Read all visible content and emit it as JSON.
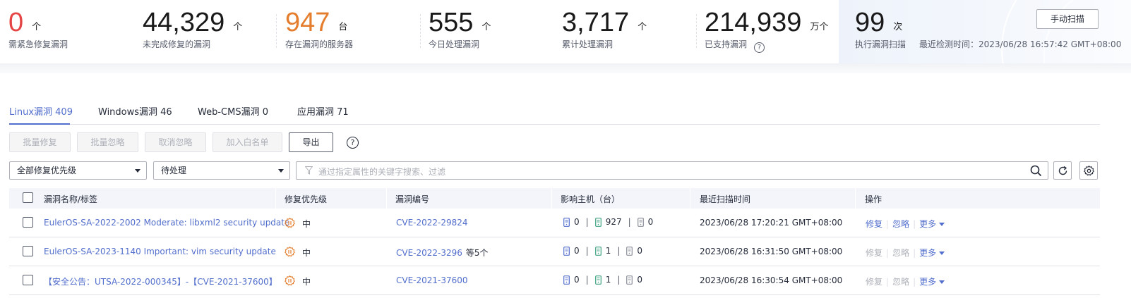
{
  "stats": [
    {
      "value": "0",
      "unit": "个",
      "label": "需紧急修复漏洞"
    },
    {
      "value": "44,329",
      "unit": "个",
      "label": "未完成修复的漏洞"
    },
    {
      "value": "947",
      "unit": "台",
      "label": "存在漏洞的服务器"
    },
    {
      "value": "555",
      "unit": "个",
      "label": "今日处理漏洞"
    },
    {
      "value": "3,717",
      "unit": "个",
      "label": "累计处理漏洞"
    },
    {
      "value": "214,939",
      "unit": "万个",
      "label": "已支持漏洞"
    }
  ],
  "scan": {
    "value": "99",
    "unit": "次",
    "label": "执行漏洞扫描",
    "last_check": "最近检测时间：2023/06/28 16:57:42 GMT+08:00",
    "manual_button": "手动扫描"
  },
  "colors": {
    "urgent": "#e54545",
    "server": "#e47d2d",
    "accent": "#526ecc"
  },
  "tabs": [
    {
      "label": "Linux漏洞 409"
    },
    {
      "label": "Windows漏洞 46"
    },
    {
      "label": "Web-CMS漏洞 0"
    },
    {
      "label": "应用漏洞 71"
    }
  ],
  "toolbar": {
    "batch_fix": "批量修复",
    "batch_ignore": "批量忽略",
    "cancel_ignore": "取消忽略",
    "add_whitelist": "加入白名单",
    "export": "导出"
  },
  "filters": {
    "priority": "全部修复优先级",
    "status": "待处理",
    "search_placeholder": "通过指定属性的关键字搜索、过滤"
  },
  "table": {
    "headers": {
      "name": "漏洞名称/标签",
      "priority": "修复优先级",
      "id": "漏洞编号",
      "hosts": "影响主机（台）",
      "last_scan": "最近扫描时间",
      "ops": "操作"
    },
    "rows": [
      {
        "name": "EulerOS-SA-2022-2002 Moderate: libxml2 security update",
        "priority": "中",
        "cve": "CVE-2022-29824",
        "cve_extra": "",
        "hosts": [
          "0",
          "927",
          "0"
        ],
        "time": "2023/06/28 17:20:21 GMT+08:00",
        "fix": "修复",
        "ignore": "忽略",
        "more": "更多",
        "ops_enabled": true
      },
      {
        "name": "EulerOS-SA-2023-1140 Important: vim security update",
        "priority": "中",
        "cve": "CVE-2022-3296",
        "cve_extra": "等5个",
        "hosts": [
          "0",
          "1",
          "0"
        ],
        "time": "2023/06/28 16:31:50 GMT+08:00",
        "fix": "修复",
        "ignore": "忽略",
        "more": "更多",
        "ops_enabled": false
      },
      {
        "name": "【安全公告：UTSA-2022-000345】-【CVE-2021-37600】",
        "priority": "中",
        "cve": "CVE-2021-37600",
        "cve_extra": "",
        "hosts": [
          "0",
          "1",
          "0"
        ],
        "time": "2023/06/28 16:30:54 GMT+08:00",
        "fix": "修复",
        "ignore": "忽略",
        "more": "更多",
        "ops_enabled": false
      }
    ]
  }
}
